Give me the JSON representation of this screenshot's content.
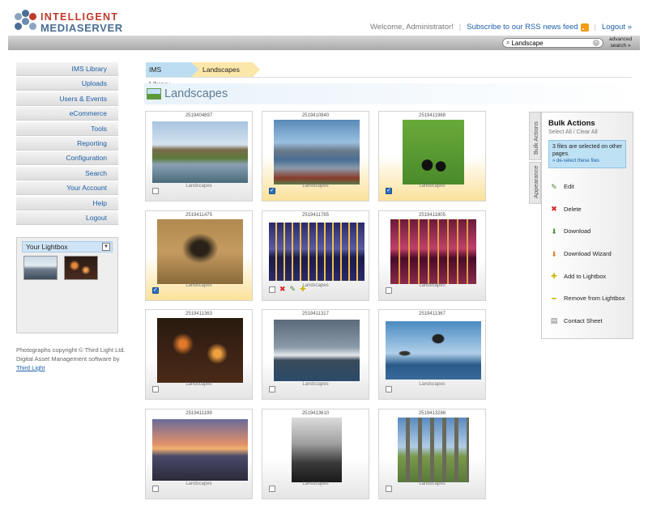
{
  "logo": {
    "line1": "INTELLIGENT",
    "line2": "MEDIASERVER"
  },
  "toplinks": {
    "welcome": "Welcome, Administrator!",
    "rss": "Subscribe to our RSS news feed",
    "logout": "Logout »"
  },
  "search": {
    "value": "Landscape",
    "advanced_line1": "advanced",
    "advanced_line2": "search »"
  },
  "nav": [
    "IMS Library",
    "Uploads",
    "Users & Events",
    "eCommerce",
    "Tools",
    "Reporting",
    "Configuration",
    "Search",
    "Your Account",
    "Help",
    "Logout"
  ],
  "lightbox": {
    "title": "Your Lightbox"
  },
  "copyright": {
    "text": "Photographs copyright © Third Light Ltd. Digital Asset Management software by",
    "link": "Third Light"
  },
  "breadcrumbs": [
    "IMS Library",
    "Landscapes"
  ],
  "page_title": "Landscapes",
  "grid": [
    {
      "id": "2519404897",
      "collection": "Landscapes",
      "selected": false,
      "scene": "college"
    },
    {
      "id": "2519410840",
      "collection": "Landscapes",
      "selected": true,
      "scene": "fjord"
    },
    {
      "id": "2519411968",
      "collection": "Landscapes",
      "selected": true,
      "scene": "puffins"
    },
    {
      "id": "2519411475",
      "collection": "Landscapes",
      "selected": true,
      "scene": "tree"
    },
    {
      "id": "2519411785",
      "collection": "Landscapes",
      "selected": false,
      "scene": "pier"
    },
    {
      "id": "2519411805",
      "collection": "Landscapes",
      "selected": false,
      "scene": "pier-red"
    },
    {
      "id": "2519411363",
      "collection": "Landscapes",
      "selected": false,
      "scene": "city"
    },
    {
      "id": "2519411317",
      "collection": "Landscapes",
      "selected": false,
      "scene": "mountains"
    },
    {
      "id": "2519411367",
      "collection": "Landscapes",
      "selected": false,
      "scene": "birds"
    },
    {
      "id": "2519411199",
      "collection": "Landscapes",
      "selected": false,
      "scene": "sunset"
    },
    {
      "id": "2519413610",
      "collection": "Landscapes",
      "selected": false,
      "scene": "rocks-bw"
    },
    {
      "id": "2519413286",
      "collection": "Landscapes",
      "selected": false,
      "scene": "stones"
    }
  ],
  "bulk": {
    "tabs": [
      "Bulk Actions",
      "Appearance"
    ],
    "title": "Bulk Actions",
    "select_all": "Select All",
    "clear_all": "Clear All",
    "notice": "3 files are selected on other pages.",
    "deselect": "» de-select these files",
    "actions": [
      {
        "label": "Edit",
        "icon": "edit-icon"
      },
      {
        "label": "Delete",
        "icon": "delete-icon"
      },
      {
        "label": "Download",
        "icon": "download-icon"
      },
      {
        "label": "Download Wizard",
        "icon": "download-wizard-icon"
      },
      {
        "label": "Add to Lightbox",
        "icon": "add-icon"
      },
      {
        "label": "Remove from Lightbox",
        "icon": "remove-icon"
      },
      {
        "label": "Contact Sheet",
        "icon": "contact-sheet-icon"
      }
    ]
  },
  "colors": {
    "brand_red": "#c0392b",
    "brand_blue": "#4a6e94",
    "link": "#1d5fa8",
    "selected_bg": "#fbe19a"
  }
}
